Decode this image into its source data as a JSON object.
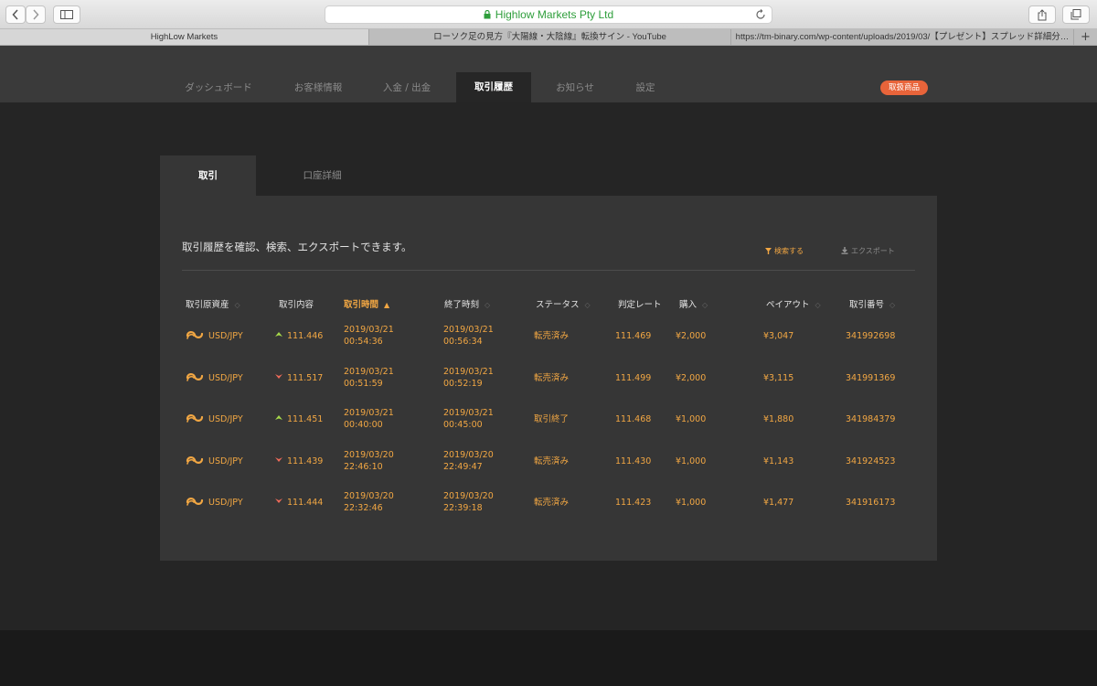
{
  "browser": {
    "url_bar_text": "Highlow Markets Pty Ltd",
    "tabs": [
      {
        "label": "HighLow Markets",
        "active": true
      },
      {
        "label": "ローソク足の見方『大陽線・大陰線』転換サイン - YouTube",
        "active": false
      },
      {
        "label": "https://tm-binary.com/wp-content/uploads/2019/03/【プレゼント】スプレッド詳細分…",
        "active": false
      }
    ],
    "new_tab_label": "+"
  },
  "nav": {
    "items": [
      {
        "label": "ダッシュボード"
      },
      {
        "label": "お客様情報"
      },
      {
        "label": "入金 / 出金"
      },
      {
        "label": "取引履歴",
        "active": true
      },
      {
        "label": "お知らせ"
      },
      {
        "label": "設定"
      }
    ],
    "product_button": "取扱商品",
    "product_color": "#e8643a"
  },
  "subtabs": [
    {
      "label": "取引",
      "active": true
    },
    {
      "label": "口座詳細"
    }
  ],
  "card": {
    "description": "取引履歴を確認、検索、エクスポートできます。",
    "search_label": "検索する",
    "export_label": "エクスポート"
  },
  "table": {
    "headers": [
      "取引原資産",
      "取引内容",
      "取引時間",
      "終了時刻",
      "ステータス",
      "判定レート",
      "購入",
      "ペイアウト",
      "取引番号"
    ],
    "sorted_column": 2,
    "rows": [
      {
        "asset": "USD/JPY",
        "direction": "up",
        "rate": "111.446",
        "trade_date": "2019/03/21",
        "trade_time": "00:54:36",
        "end_date": "2019/03/21",
        "end_time": "00:56:34",
        "status": "転売済み",
        "judge_rate": "111.469",
        "purchase": "¥2,000",
        "payout": "¥3,047",
        "trade_no": "341992698"
      },
      {
        "asset": "USD/JPY",
        "direction": "down",
        "rate": "111.517",
        "trade_date": "2019/03/21",
        "trade_time": "00:51:59",
        "end_date": "2019/03/21",
        "end_time": "00:52:19",
        "status": "転売済み",
        "judge_rate": "111.499",
        "purchase": "¥2,000",
        "payout": "¥3,115",
        "trade_no": "341991369"
      },
      {
        "asset": "USD/JPY",
        "direction": "up",
        "rate": "111.451",
        "trade_date": "2019/03/21",
        "trade_time": "00:40:00",
        "end_date": "2019/03/21",
        "end_time": "00:45:00",
        "status": "取引終了",
        "judge_rate": "111.468",
        "purchase": "¥1,000",
        "payout": "¥1,880",
        "trade_no": "341984379"
      },
      {
        "asset": "USD/JPY",
        "direction": "down",
        "rate": "111.439",
        "trade_date": "2019/03/20",
        "trade_time": "22:46:10",
        "end_date": "2019/03/20",
        "end_time": "22:49:47",
        "status": "転売済み",
        "judge_rate": "111.430",
        "purchase": "¥1,000",
        "payout": "¥1,143",
        "trade_no": "341924523"
      },
      {
        "asset": "USD/JPY",
        "direction": "down",
        "rate": "111.444",
        "trade_date": "2019/03/20",
        "trade_time": "22:32:46",
        "end_date": "2019/03/20",
        "end_time": "22:39:18",
        "status": "転売済み",
        "judge_rate": "111.423",
        "purchase": "¥1,000",
        "payout": "¥1,477",
        "trade_no": "341916173"
      }
    ]
  },
  "colors": {
    "accent": "#f2a743",
    "up": "#a6d84a",
    "down": "#ef6b5a"
  }
}
